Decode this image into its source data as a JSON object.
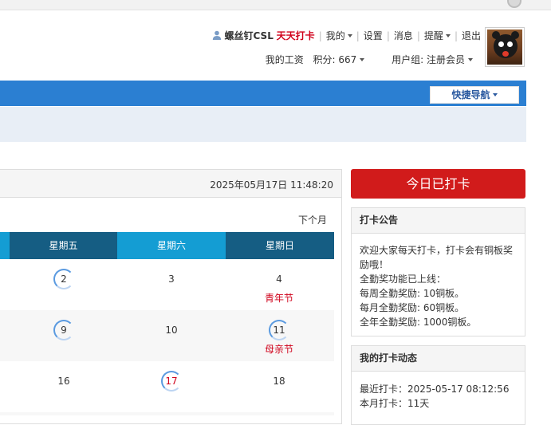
{
  "userbar": {
    "username": "螺丝钉CSL",
    "punch_link": "天天打卡",
    "my": "我的",
    "settings": "设置",
    "messages": "消息",
    "reminders": "提醒",
    "logout": "退出"
  },
  "userbar2": {
    "wage": "我的工资",
    "points": "积分: 667",
    "group": "用户组: 注册会员"
  },
  "nav": {
    "quick_nav": "快捷导航"
  },
  "calendar": {
    "datetime": "2025年05月17日 11:48:20",
    "next_month": "下个月",
    "weekdays": [
      "星期五",
      "星期六",
      "星期日"
    ],
    "rows": [
      {
        "fri": "2",
        "sat": "3",
        "sun": "4",
        "sun_festival": "青年节"
      },
      {
        "fri": "9",
        "sat": "10",
        "sun": "11",
        "sun_festival": "母亲节"
      },
      {
        "fri": "16",
        "sat": "17",
        "sun": "18"
      }
    ]
  },
  "sidebar": {
    "punched_button": "今日已打卡",
    "notice_title": "打卡公告",
    "notice_lines": [
      "欢迎大家每天打卡，打卡会有铜板奖",
      "励哦！",
      "全勤奖功能已上线：",
      "每周全勤奖励: 10铜板。",
      "每月全勤奖励: 60铜板。",
      "全年全勤奖励: 1000铜板。"
    ],
    "activity_title": "我的打卡动态",
    "activity_lines": [
      "最近打卡：2025-05-17 08:12:56",
      "本月打卡：11天"
    ]
  },
  "colors": {
    "nav_blue": "#2b7fd2",
    "header_dark": "#155d83",
    "header_light": "#149dd3",
    "punch_red": "#d11b1b",
    "festival_red": "#d0021b"
  }
}
